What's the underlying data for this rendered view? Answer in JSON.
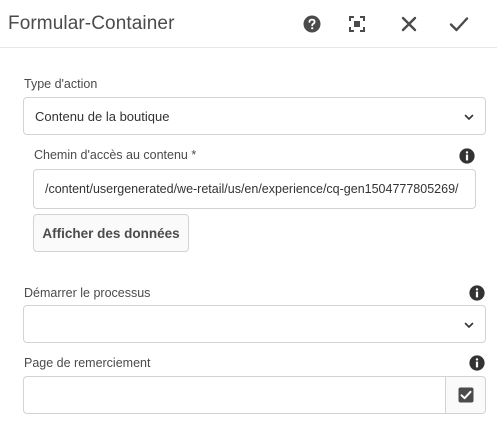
{
  "dialog": {
    "title": "Formular-Container",
    "actions": {
      "help_icon": "help-icon",
      "fullscreen_icon": "fullscreen-icon",
      "close_icon": "close-icon",
      "done_icon": "check-icon"
    }
  },
  "action_type": {
    "label": "Type d'action",
    "value": "Contenu de la boutique"
  },
  "content_path": {
    "label": "Chemin d'accès au contenu *",
    "value": "/content/usergenerated/we-retail/us/en/experience/cq-gen1504777805269/",
    "button_label": "Afficher des données"
  },
  "workflow": {
    "label": "Démarrer le processus",
    "value": ""
  },
  "thank_you_page": {
    "label": "Page de remerciement",
    "value": ""
  },
  "colors": {
    "icon": "#4b4b4b",
    "border": "#d3d3d3",
    "text": "#333333"
  }
}
